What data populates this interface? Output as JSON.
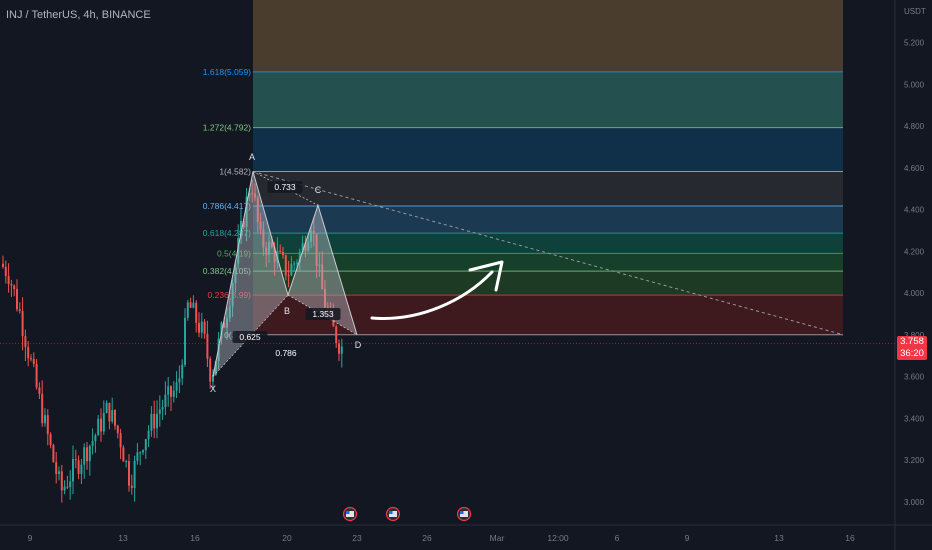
{
  "header": {
    "symbol": "INJ / TetherUS, 4h, BINANCE"
  },
  "price_axis": {
    "currency": "USDT"
  },
  "last_price": {
    "value": "3.758",
    "countdown": "36:20"
  },
  "colors": {
    "background": "#131722",
    "up_candle": "#26a69a",
    "down_candle": "#ef5350",
    "pattern_fill": "#b2b5be",
    "current_price": "#f23645"
  },
  "chart_data": {
    "type": "candlestick",
    "title": "INJ / TetherUS, 4h, BINANCE",
    "y_axis": {
      "unit": "USDT",
      "ticks": [
        "5.200",
        "5.000",
        "4.800",
        "4.600",
        "4.400",
        "4.200",
        "4.000",
        "3.800",
        "3.600",
        "3.400",
        "3.200",
        "3.000"
      ],
      "range": [
        2.95,
        5.44
      ]
    },
    "x_axis": {
      "ticks": [
        "9",
        "13",
        "16",
        "20",
        "23",
        "26",
        "Mar",
        "12:00",
        "6",
        "9",
        "13",
        "16"
      ]
    },
    "last_price": 3.758,
    "fib_levels": [
      {
        "label": "1.618(5.059)",
        "value": 5.059,
        "color": "#2196f3"
      },
      {
        "label": "1.272(4.792)",
        "value": 4.792,
        "color": "#81c784"
      },
      {
        "label": "1(4.582)",
        "value": 4.582,
        "color": "#b2b5be"
      },
      {
        "label": "0.786(4.417)",
        "value": 4.417,
        "color": "#64b5f6"
      },
      {
        "label": "0.618(4.287)",
        "value": 4.287,
        "color": "#26a69a"
      },
      {
        "label": "0.5(4.19)",
        "value": 4.19,
        "color": "#4caf50"
      },
      {
        "label": "0.382(4.105)",
        "value": 4.105,
        "color": "#81c784"
      },
      {
        "label": "0.236(3.99)",
        "value": 3.99,
        "color": "#f23645"
      },
      {
        "label": "0(3.80)",
        "value": 3.8,
        "color": "#b2b5be"
      }
    ],
    "fib_zone_top": 5.44,
    "harmonic_pattern": {
      "points": [
        {
          "label": "X",
          "price": 3.6
        },
        {
          "label": "A",
          "price": 4.582
        },
        {
          "label": "B",
          "price": 3.99
        },
        {
          "label": "C",
          "price": 4.42
        },
        {
          "label": "D",
          "price": 3.8
        }
      ],
      "ratios": [
        "0.733",
        "0.625",
        "0.786",
        "1.353"
      ]
    },
    "event_markers": 3,
    "trendline": {
      "from_price": 4.582,
      "to_price": 3.8,
      "style": "dashed"
    }
  }
}
